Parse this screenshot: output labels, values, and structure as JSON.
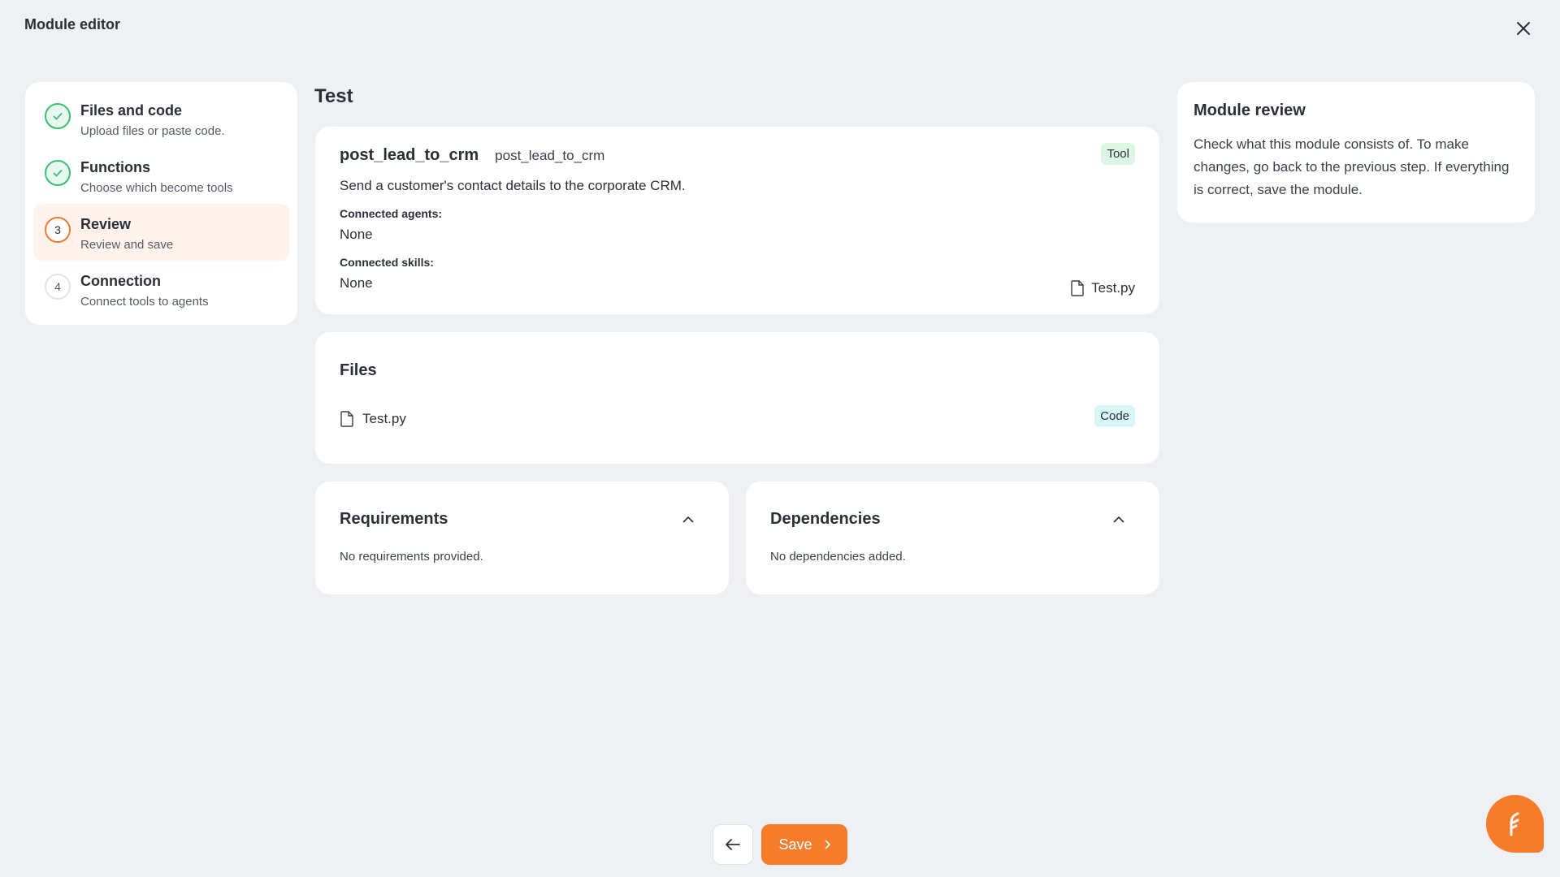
{
  "header": {
    "title": "Module editor"
  },
  "steps": [
    {
      "number": "1",
      "title": "Files and code",
      "subtitle": "Upload files or paste code.",
      "status": "done"
    },
    {
      "number": "2",
      "title": "Functions",
      "subtitle": "Choose which become tools",
      "status": "done"
    },
    {
      "number": "3",
      "title": "Review",
      "subtitle": "Review and save",
      "status": "current"
    },
    {
      "number": "4",
      "title": "Connection",
      "subtitle": "Connect tools to agents",
      "status": "todo"
    }
  ],
  "main": {
    "title": "Test",
    "tool": {
      "name": "post_lead_to_crm",
      "id": "post_lead_to_crm",
      "badge": "Tool",
      "description": "Send a customer's contact details to the corporate CRM.",
      "agents_label": "Connected agents:",
      "agents_value": "None",
      "skills_label": "Connected skills:",
      "skills_value": "None",
      "file": "Test.py"
    },
    "files": {
      "title": "Files",
      "items": [
        {
          "name": "Test.py",
          "badge": "Code"
        }
      ]
    },
    "requirements": {
      "title": "Requirements",
      "body": "No requirements provided."
    },
    "dependencies": {
      "title": "Dependencies",
      "body": "No dependencies added."
    }
  },
  "review": {
    "title": "Module review",
    "text": "Check what this module consists of. To make changes, go back to the previous step. If everything is correct, save the module."
  },
  "footer": {
    "save_label": "Save"
  },
  "colors": {
    "accent": "#f47c2a",
    "done": "#38c172",
    "background": "#eef0f4"
  },
  "icons": [
    "close-icon",
    "check-icon",
    "file-icon",
    "chevron-up-icon",
    "arrow-left-icon",
    "chevron-right-icon",
    "chat-icon"
  ]
}
